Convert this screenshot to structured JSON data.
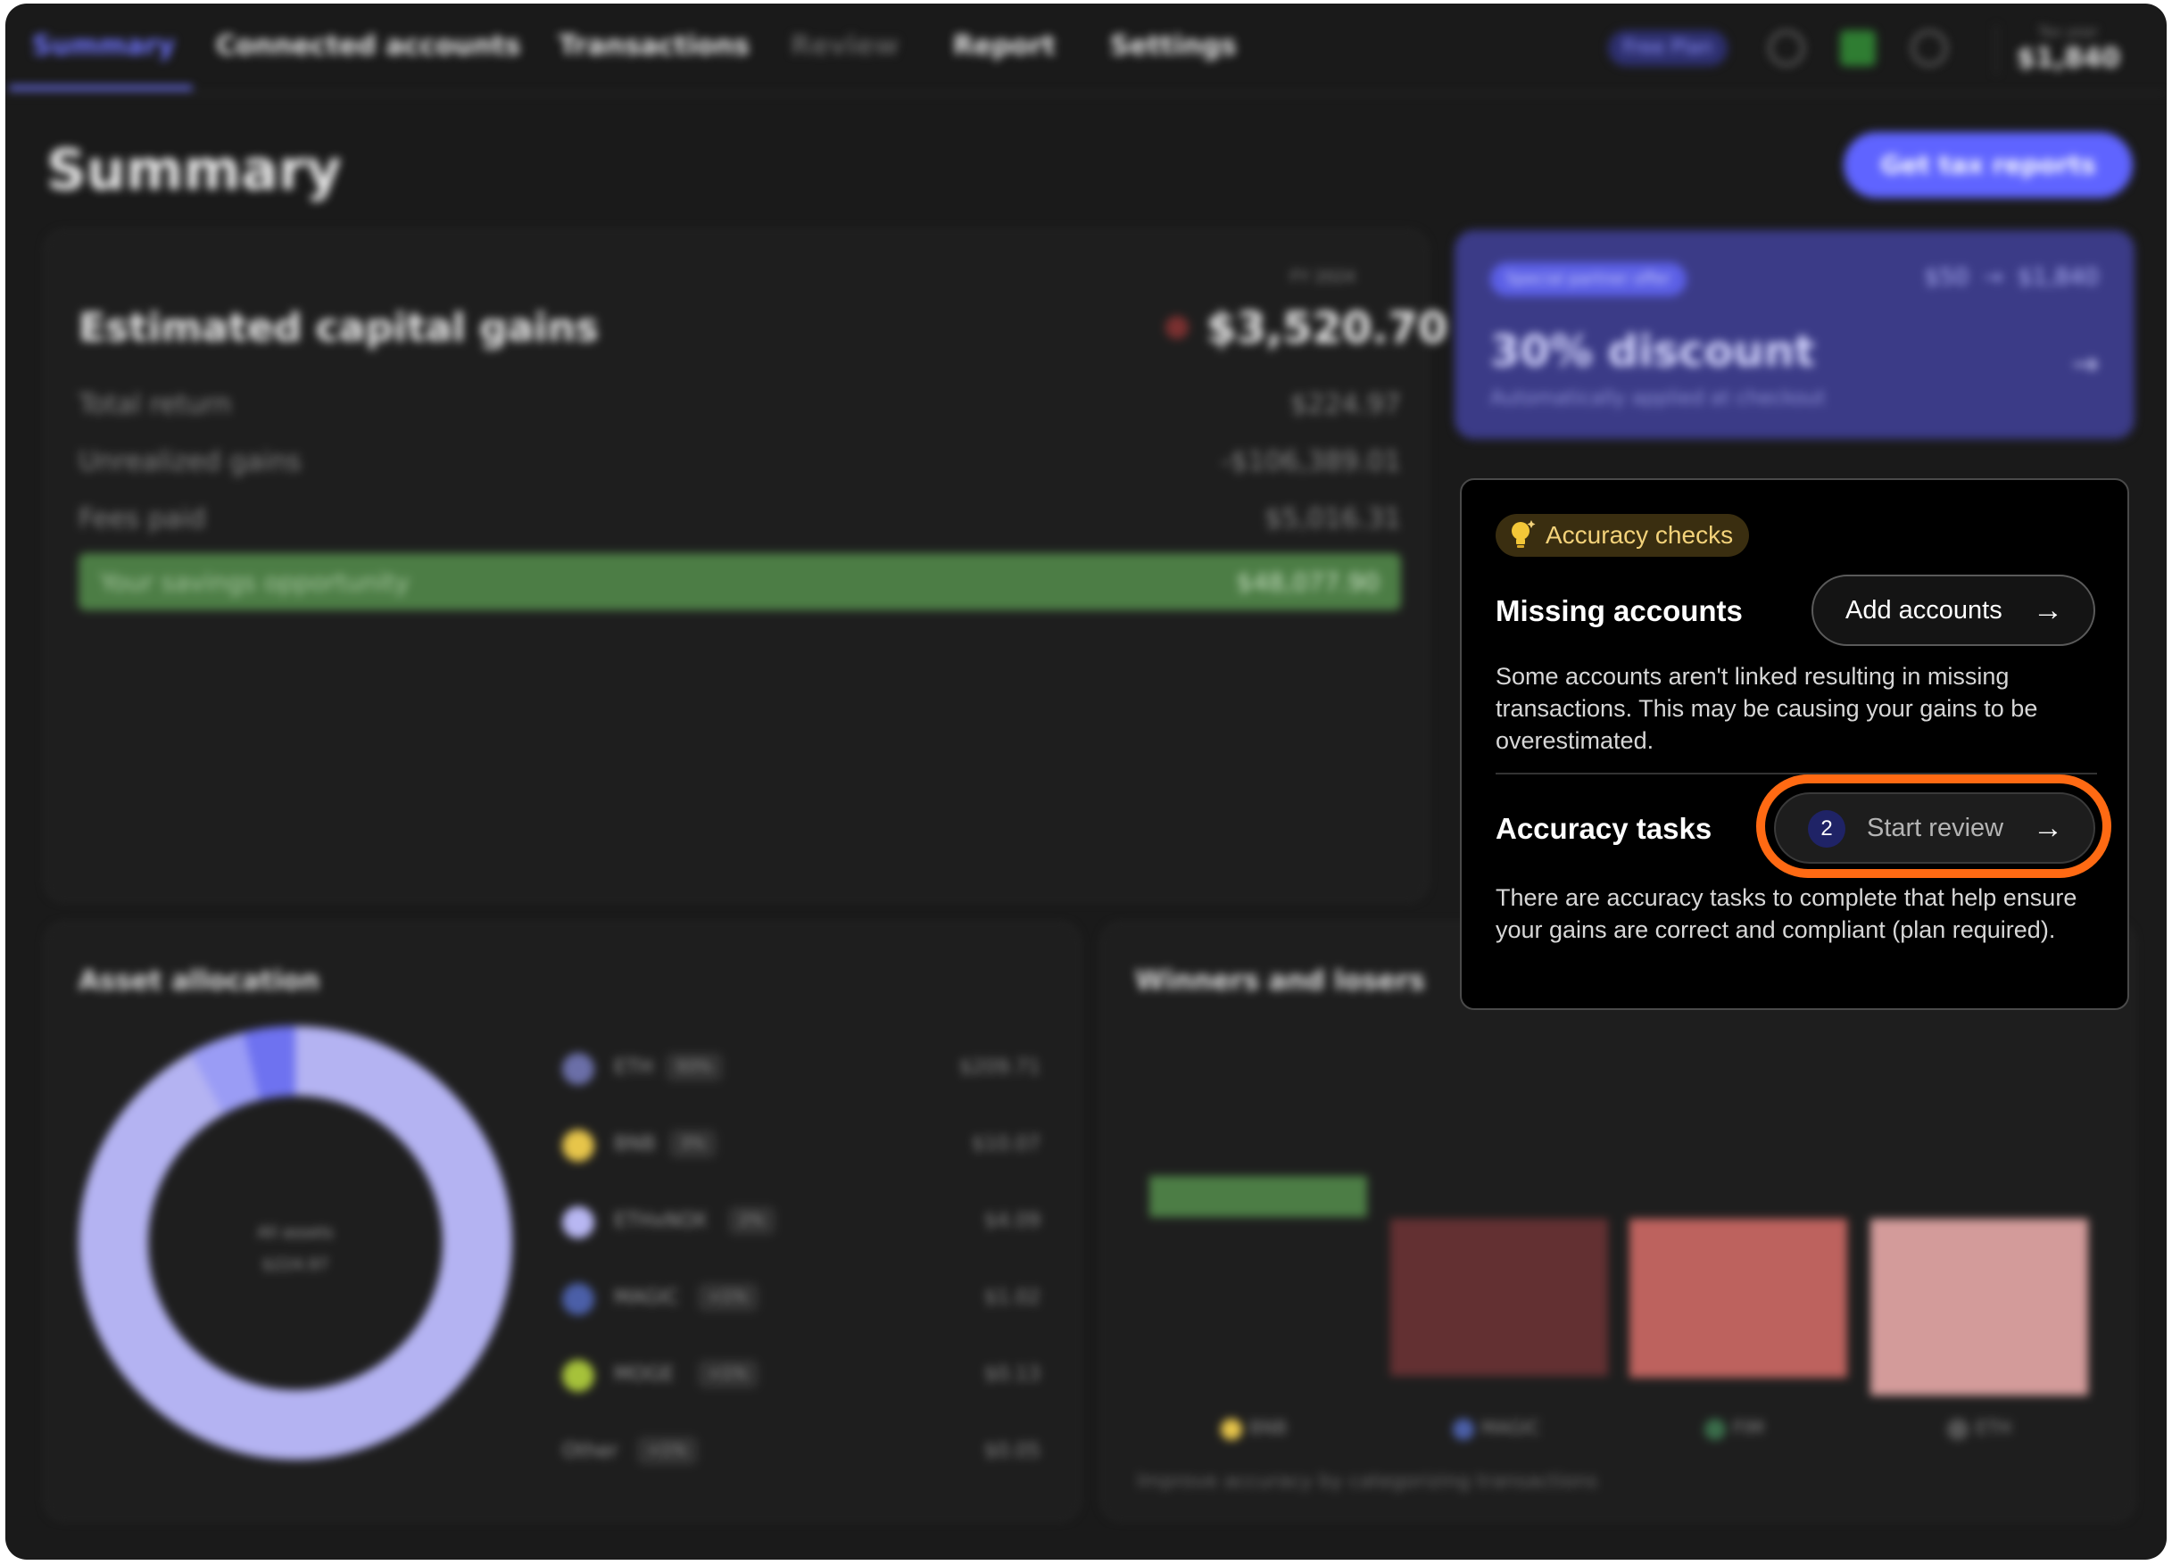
{
  "nav": {
    "tabs": [
      "Summary",
      "Connected accounts",
      "Transactions",
      "Review",
      "Report",
      "Settings"
    ],
    "active_tab": "Summary",
    "plan_badge": "Free Plan",
    "plan_small": "Tax year",
    "plan_value": "$1,840"
  },
  "header": {
    "title": "Summary",
    "cta": "Get tax reports"
  },
  "gains_card": {
    "small_label": "FY 2024",
    "title": "Estimated capital gains",
    "value": "$3,520.70",
    "rows": [
      {
        "label": "Total return",
        "value": "$224.97"
      },
      {
        "label": "Unrealized gains",
        "value": "-$106,389.01"
      },
      {
        "label": "Fees paid",
        "value": "$5,016.31"
      }
    ],
    "savings_label": "Your savings opportunity",
    "savings_value": "$48,077.90"
  },
  "promo": {
    "pill": "Special partner offer",
    "old_price": "$50",
    "new_price": "$1,840",
    "title": "30% discount",
    "subtitle": "Automatically applied at checkout"
  },
  "asset_allocation": {
    "title": "Asset allocation",
    "center_label": "All assets",
    "center_value": "$224.97",
    "legend": [
      {
        "name": "ETH",
        "pct": "93%",
        "value": "$209.71",
        "color": "#6b6fa8"
      },
      {
        "name": "BNB",
        "pct": "3%",
        "value": "$10.07",
        "color": "#e7c54a"
      },
      {
        "name": "ETHxNOX",
        "pct": "2%",
        "value": "$4.09",
        "color": "#b8b7f2"
      },
      {
        "name": "MAGIC",
        "pct": "<1%",
        "value": "$1.02",
        "color": "#4b5fa8"
      },
      {
        "name": "MOGE",
        "pct": "<1%",
        "value": "$0.13",
        "color": "#a6c23a"
      },
      {
        "name": "Other",
        "pct": "<1%",
        "value": "$0.05",
        "color": "#555555"
      }
    ]
  },
  "winners_losers": {
    "title": "Winners and losers",
    "labels": [
      "BNB",
      "MAGIC",
      "FIM",
      "ETH"
    ],
    "footnote": "Improve accuracy by categorizing transactions"
  },
  "accuracy_popover": {
    "chip": "Accuracy checks",
    "missing_title": "Missing accounts",
    "missing_button": "Add accounts",
    "missing_text": "Some accounts aren't linked resulting in missing transactions. This may be causing your gains to be overestimated.",
    "tasks_title": "Accuracy tasks",
    "tasks_count": "2",
    "tasks_button": "Start review",
    "tasks_text": "There are accuracy tasks to complete that help ensure your gains are correct and compliant (plan required)."
  }
}
